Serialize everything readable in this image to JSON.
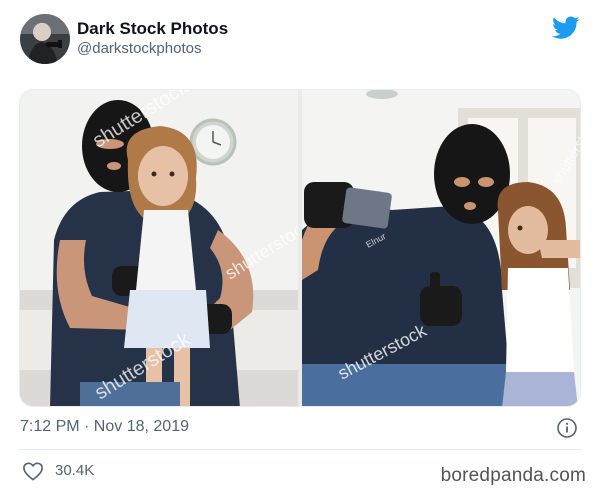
{
  "tweet": {
    "author": {
      "display_name": "Dark Stock Photos",
      "handle": "@darkstockphotos",
      "avatar_icon": "avatar-photo"
    },
    "platform_icon": "twitter-bird-icon",
    "brand_color": "#1d9bf0",
    "media": [
      {
        "name": "photo-left",
        "watermark": "shutterstock",
        "description_icon": "masked-man-hugging-girl-photo"
      },
      {
        "name": "photo-right",
        "watermark": "shutterstock",
        "credit": "Elnur",
        "description_icon": "masked-man-selfie-photo"
      }
    ],
    "timestamp": "7:12 PM · Nov 18, 2019",
    "likes": "30.4K"
  },
  "site_watermark": "boredpanda.com"
}
